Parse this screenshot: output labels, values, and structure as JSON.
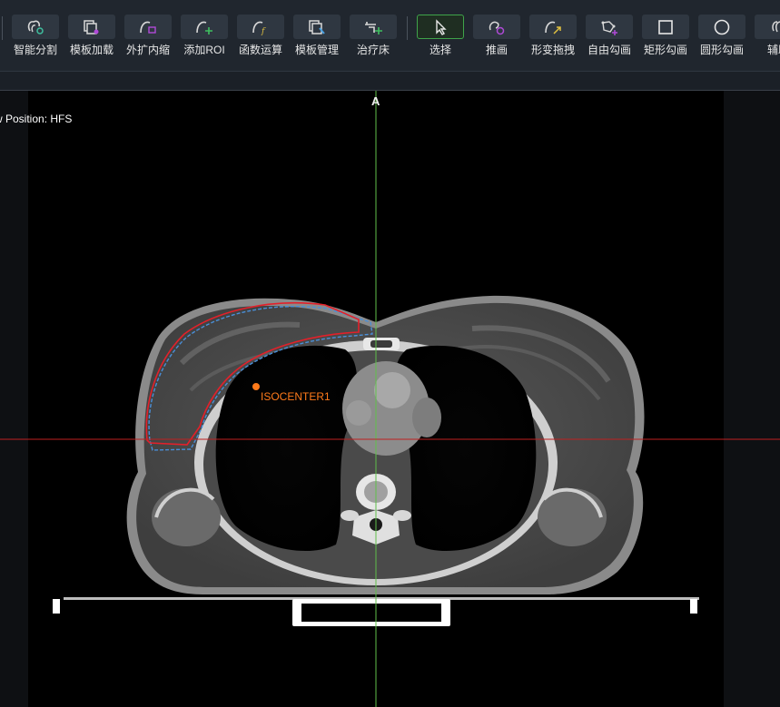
{
  "toolbar": {
    "tools": [
      {
        "label": "智能分割",
        "icon": "smart-segment-icon"
      },
      {
        "label": "模板加载",
        "icon": "template-load-icon"
      },
      {
        "label": "外扩内缩",
        "icon": "expand-shrink-icon"
      },
      {
        "label": "添加ROI",
        "icon": "add-roi-icon"
      },
      {
        "label": "函数运算",
        "icon": "function-calc-icon"
      },
      {
        "label": "模板管理",
        "icon": "template-manage-icon"
      },
      {
        "label": "治疗床",
        "icon": "treatment-couch-icon"
      },
      {
        "label": "选择",
        "icon": "select-cursor-icon",
        "active": true
      },
      {
        "label": "推画",
        "icon": "push-draw-icon"
      },
      {
        "label": "形变拖拽",
        "icon": "deform-drag-icon"
      },
      {
        "label": "自由勾画",
        "icon": "freehand-draw-icon"
      },
      {
        "label": "矩形勾画",
        "icon": "rectangle-draw-icon"
      },
      {
        "label": "圆形勾画",
        "icon": "circle-draw-icon"
      },
      {
        "label": "辅助",
        "icon": "assist-icon"
      }
    ],
    "colors": {
      "active_border": "#3fa44a",
      "icon_green": "#3fbf5f",
      "icon_purple": "#b04ad8",
      "icon_yellow": "#e0c040"
    }
  },
  "viewer": {
    "orientation_label": "A",
    "view_position": "w Position: HFS",
    "isocenter_label": "ISOCENTER1",
    "colors": {
      "vertical_line": "#5fbf4a",
      "horizontal_line": "#c02020",
      "contour_red": "#e3202a",
      "contour_blue": "#4a8fd8",
      "isocenter": "#ff7a1a"
    }
  }
}
